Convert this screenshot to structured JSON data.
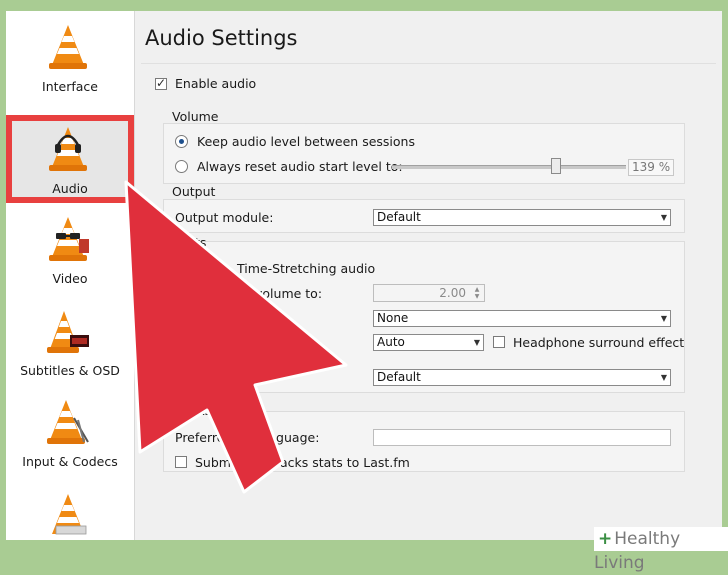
{
  "sidebar": {
    "items": [
      {
        "label": "Interface",
        "icon": "vlc-cone-icon"
      },
      {
        "label": "Audio",
        "icon": "vlc-cone-headphones-icon",
        "selected": true
      },
      {
        "label": "Video",
        "icon": "vlc-cone-glasses-icon"
      },
      {
        "label": "Subtitles & OSD",
        "icon": "vlc-cone-clock-icon"
      },
      {
        "label": "Input & Codecs",
        "icon": "vlc-cone-cable-icon"
      },
      {
        "label": "",
        "icon": "vlc-cone-icon"
      }
    ]
  },
  "main": {
    "title": "Audio Settings",
    "enable_audio": {
      "label": "Enable audio",
      "checked": true
    },
    "volume": {
      "title": "Volume",
      "keep_level_label": "Keep audio level between sessions",
      "reset_level_label": "Always reset audio start level to:",
      "slider_value": "139 %",
      "slider_fraction": 0.69
    },
    "output": {
      "title": "Output",
      "module_label": "Output module:",
      "module_value": "Default"
    },
    "effects": {
      "title_fragment": "ts",
      "time_stretch_label": "Time-Stretching audio",
      "volume_label_fragment": "volume to:",
      "volume_value": "2.00",
      "combo1_value": "None",
      "combo2_value": "Auto",
      "headphone_label": "Headphone surround effect",
      "combo3_value": "Default"
    },
    "tracks": {
      "title_fragment": "Tracks",
      "pref_lang_label_a": "Preferre",
      "pref_lang_label_b": "language:",
      "submit_label_a": "Subm",
      "submit_label_b": "acks stats to Last.fm"
    }
  },
  "overlay": {
    "arrow_color": "#e02f3c"
  },
  "watermark": {
    "plus": "+",
    "text": "Healthy Living"
  }
}
